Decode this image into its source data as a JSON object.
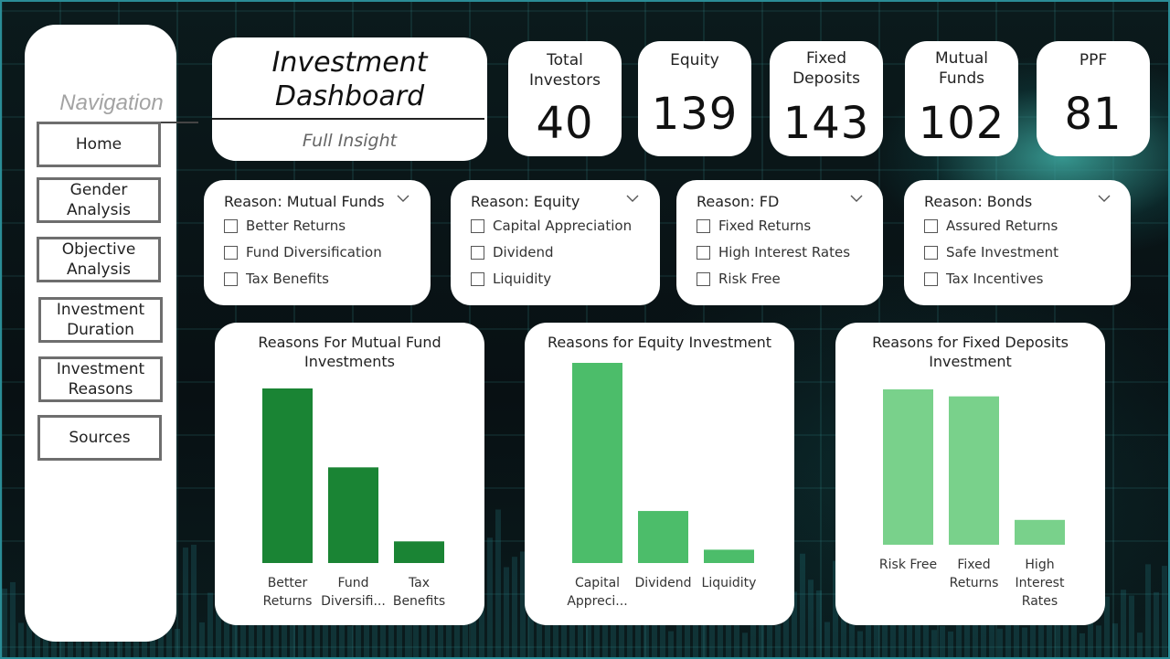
{
  "nav": {
    "title": "Navigation",
    "items": [
      {
        "label1": "Home",
        "label2": ""
      },
      {
        "label1": "Gender",
        "label2": "Analysis"
      },
      {
        "label1": "Objective",
        "label2": "Analysis"
      },
      {
        "label1": "Investment",
        "label2": "Duration"
      },
      {
        "label1": "Investment",
        "label2": "Reasons"
      },
      {
        "label1": "Sources",
        "label2": ""
      }
    ]
  },
  "header": {
    "title_line1": "Investment",
    "title_line2": "Dashboard",
    "subtitle": "Full Insight"
  },
  "kpis": [
    {
      "label1": "Total",
      "label2": "Investors",
      "value": "40"
    },
    {
      "label1": "Equity",
      "label2": "",
      "value": "139"
    },
    {
      "label1": "Fixed",
      "label2": "Deposits",
      "value": "143"
    },
    {
      "label1": "Mutual",
      "label2": "Funds",
      "value": "102"
    },
    {
      "label1": "PPF",
      "label2": "",
      "value": "81"
    }
  ],
  "slicers": [
    {
      "title": "Reason: Mutual Funds",
      "options": [
        "Better Returns",
        "Fund Diversification",
        "Tax Benefits"
      ],
      "checked": [
        false,
        false,
        false
      ]
    },
    {
      "title": "Reason: Equity",
      "options": [
        "Capital Appreciation",
        "Dividend",
        "Liquidity"
      ],
      "checked": [
        false,
        false,
        false
      ]
    },
    {
      "title": "Reason: FD",
      "options": [
        "Fixed Returns",
        "High Interest Rates",
        "Risk Free"
      ],
      "checked": [
        false,
        false,
        false
      ]
    },
    {
      "title": "Reason: Bonds",
      "options": [
        "Assured Returns",
        "Safe Investment",
        "Tax Incentives"
      ],
      "checked": [
        false,
        false,
        false
      ]
    }
  ],
  "chart_data": [
    {
      "type": "bar",
      "title_line1": "Reasons For Mutual Fund",
      "title_line2": "Investments",
      "categories": [
        [
          "Better",
          "Returns"
        ],
        [
          "Fund",
          "Diversifi..."
        ],
        [
          "Tax",
          "Benefits"
        ]
      ],
      "values": [
        25,
        13.7,
        3.1
      ],
      "ylim": [
        0,
        25
      ],
      "color": "#1a8434",
      "grid": false
    },
    {
      "type": "bar",
      "title_line1": "Reasons for Equity Investment",
      "title_line2": "",
      "categories": [
        [
          "Capital",
          "Appreci..."
        ],
        [
          "Dividend"
        ],
        [
          "Liquidity"
        ]
      ],
      "values": [
        30,
        7.8,
        2.0
      ],
      "ylim": [
        0,
        30
      ],
      "color": "#4cbd6a",
      "grid": false
    },
    {
      "type": "bar",
      "title_line1": "Reasons for Fixed Deposits",
      "title_line2": "Investment",
      "categories": [
        [
          "Risk Free"
        ],
        [
          "Fixed",
          "Returns"
        ],
        [
          "High",
          "Interest",
          "Rates"
        ]
      ],
      "values": [
        20,
        19.1,
        3.2
      ],
      "ylim": [
        0,
        20
      ],
      "color": "#79d18b",
      "grid": false
    }
  ],
  "colors": {
    "background": "#0a1416",
    "accent": "#2a8c96",
    "card": "#ffffff"
  }
}
